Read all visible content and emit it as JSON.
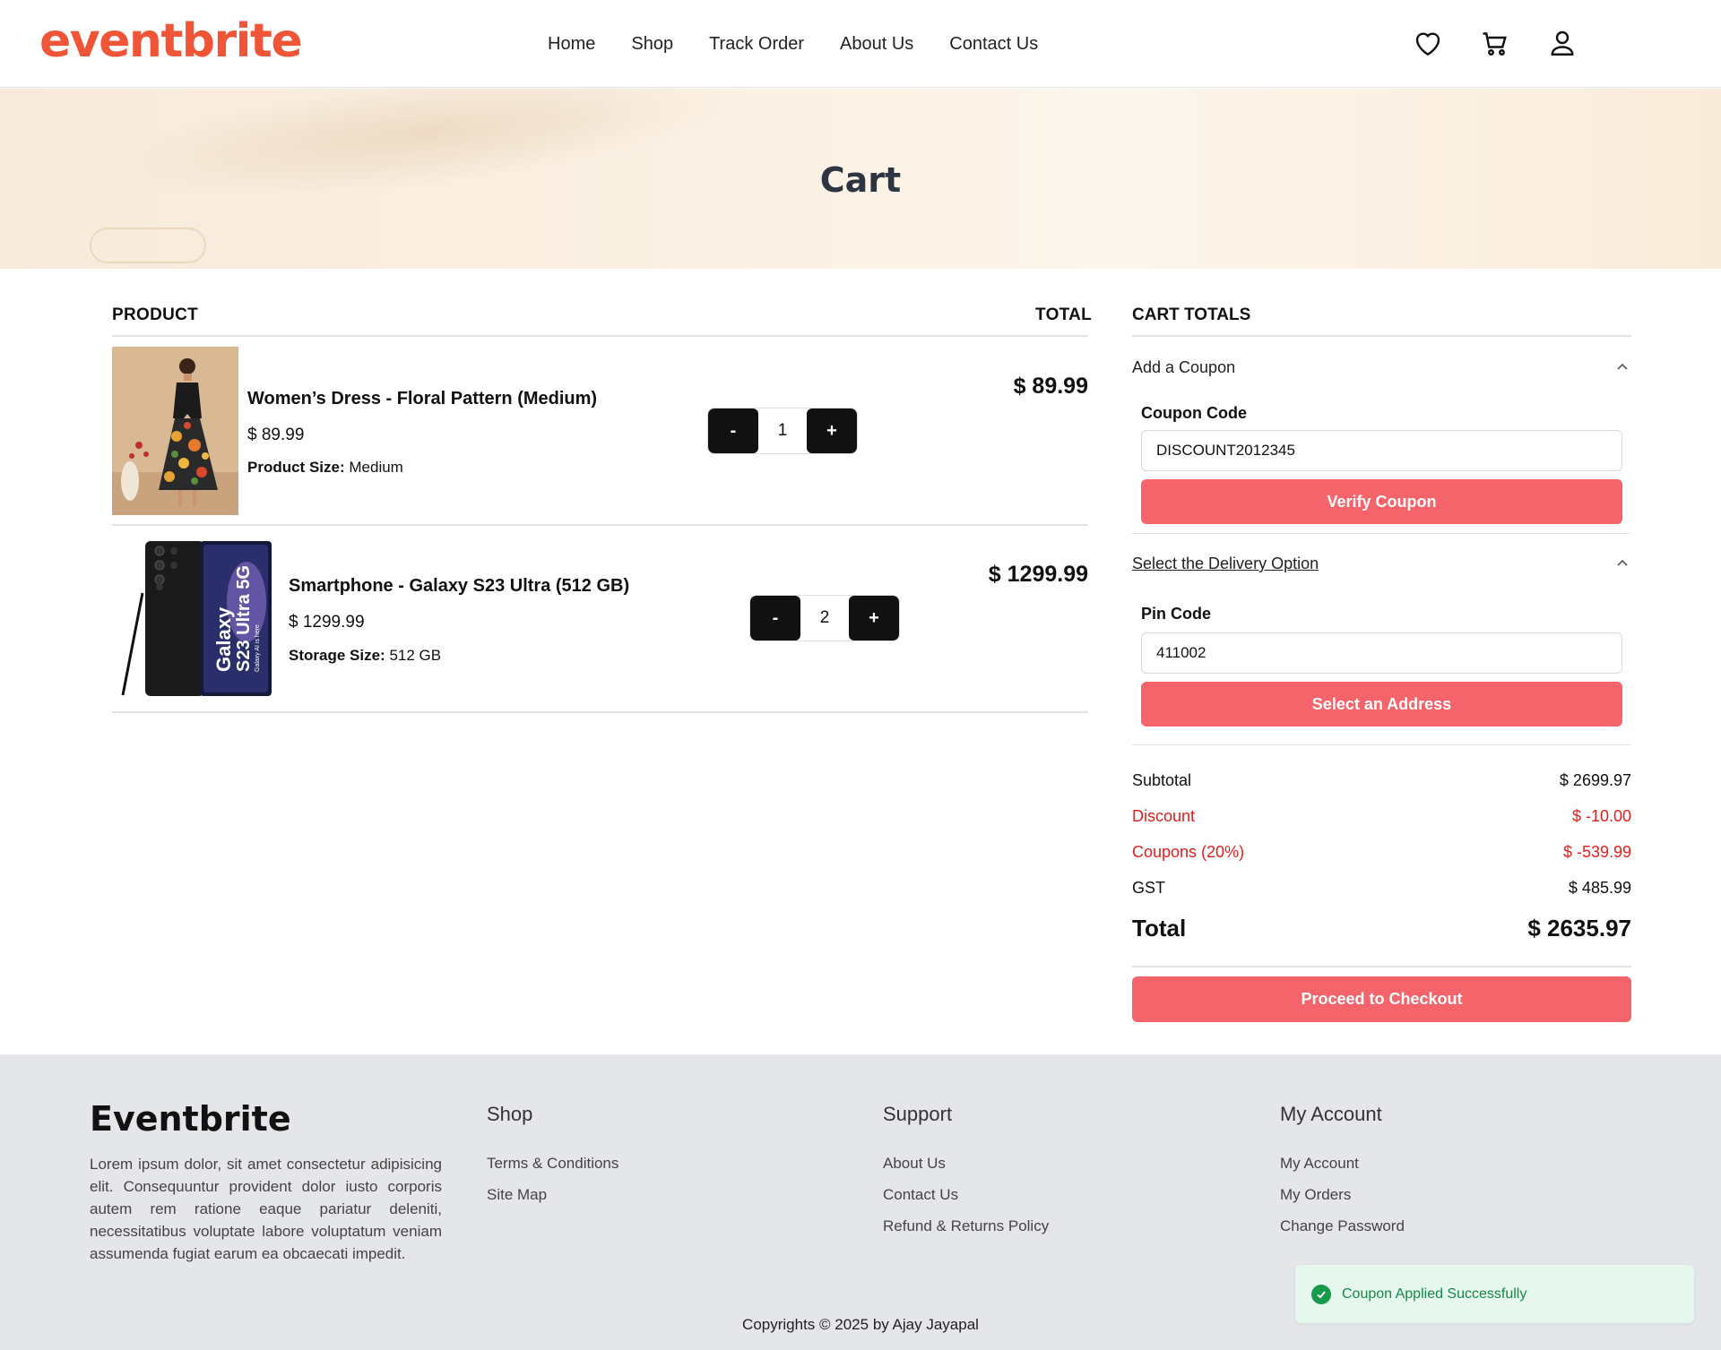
{
  "header": {
    "logo": "eventbrite",
    "nav": [
      "Home",
      "Shop",
      "Track Order",
      "About Us",
      "Contact Us"
    ],
    "icons": [
      "heart-icon",
      "cart-icon",
      "user-icon"
    ]
  },
  "banner": {
    "title": "Cart"
  },
  "table": {
    "col_product": "PRODUCT",
    "col_total": "TOTAL",
    "items": [
      {
        "name": "Women’s Dress - Floral Pattern (Medium)",
        "price": "$ 89.99",
        "attr_label": "Product Size",
        "attr_value": "Medium",
        "qty": "1",
        "total": "$ 89.99"
      },
      {
        "name": "Smartphone - Galaxy S23 Ultra (512 GB)",
        "price": "$ 1299.99",
        "attr_label": "Storage Size",
        "attr_value": "512 GB",
        "qty": "2",
        "total": "$ 1299.99"
      }
    ],
    "minus_label": "-",
    "plus_label": "+"
  },
  "phone_image_text": {
    "line1": "Galaxy",
    "line2": "S23 Ultra 5G",
    "line3": "Galaxy AI is here"
  },
  "cart_totals": {
    "title": "CART TOTALS",
    "coupon": {
      "heading": "Add a Coupon",
      "label": "Coupon Code",
      "value": "DISCOUNT2012345",
      "button": "Verify Coupon"
    },
    "delivery": {
      "heading": "Select the Delivery Option",
      "label": "Pin Code",
      "value": "411002",
      "button": "Select an Address"
    },
    "rows": [
      {
        "label": "Subtotal",
        "value": "$ 2699.97"
      },
      {
        "label": "Discount",
        "value": "$ -10.00"
      },
      {
        "label": "Coupons (20%)",
        "value": "$ -539.99"
      },
      {
        "label": "GST",
        "value": "$ 485.99"
      }
    ],
    "total_label": "Total",
    "total_value": "$ 2635.97",
    "checkout": "Proceed to Checkout",
    "accent_color": "#f4646a",
    "negative_color": "#e0201e"
  },
  "footer": {
    "brand": "Eventbrite",
    "description": "Lorem ipsum dolor, sit amet consectetur adipisicing elit. Consequuntur provident dolor iusto corporis autem rem ratione eaque pariatur deleniti, necessitatibus voluptate labore voluptatum veniam assumenda fugiat earum ea obcaecati impedit.",
    "shop": {
      "heading": "Shop",
      "links": [
        "Terms & Conditions",
        "Site Map"
      ]
    },
    "support": {
      "heading": "Support",
      "links": [
        "About Us",
        "Contact Us",
        "Refund & Returns Policy"
      ]
    },
    "account": {
      "heading": "My Account",
      "links": [
        "My Account",
        "My Orders",
        "Change Password"
      ]
    },
    "copyright": "Copyrights © 2025 by Ajay Jayapal"
  },
  "toast": {
    "message": "Coupon Applied Successfully",
    "color": "#17874a"
  }
}
